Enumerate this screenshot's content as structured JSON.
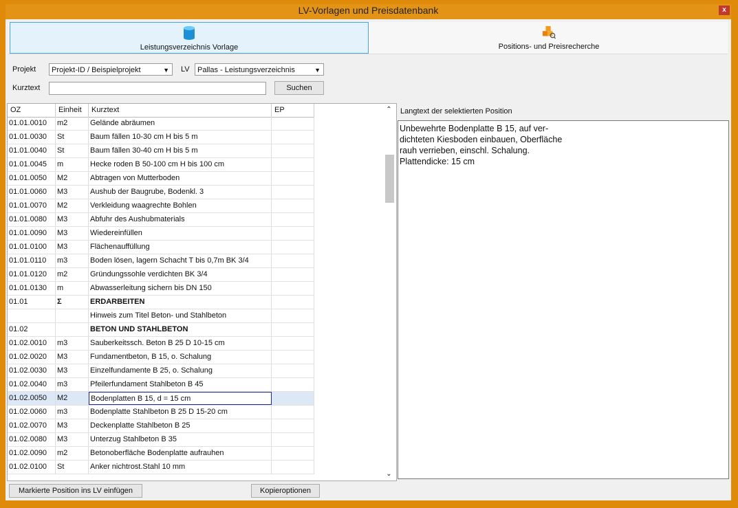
{
  "window": {
    "title": "LV-Vorlagen und Preisdatenbank",
    "close_label": "x"
  },
  "tabs": [
    {
      "label": "Leistungsverzeichnis Vorlage",
      "icon": "cylinder-database-icon",
      "active": true
    },
    {
      "label": "Positions- und Preisrecherche",
      "icon": "cubes-magnifier-icon",
      "active": false
    }
  ],
  "filters": {
    "projekt_label": "Projekt",
    "projekt_value": "Projekt-ID  / Beispielprojekt",
    "lv_label": "LV",
    "lv_value": "Pallas - Leistungsverzeichnis",
    "kurztext_label": "Kurztext",
    "kurztext_value": "",
    "search_label": "Suchen"
  },
  "table": {
    "columns": [
      "OZ",
      "Einheit",
      "Kurztext",
      "EP"
    ],
    "rows": [
      {
        "oz": "01.01.0010",
        "einheit": "m2",
        "kurztext": "Gelände abräumen",
        "ep": ""
      },
      {
        "oz": "01.01.0030",
        "einheit": "St",
        "kurztext": "Baum fällen 10-30 cm H bis 5 m",
        "ep": ""
      },
      {
        "oz": "01.01.0040",
        "einheit": "St",
        "kurztext": "Baum fällen 30-40 cm H bis 5 m",
        "ep": ""
      },
      {
        "oz": "01.01.0045",
        "einheit": "m",
        "kurztext": "Hecke roden B 50-100 cm H bis 100 cm",
        "ep": ""
      },
      {
        "oz": "01.01.0050",
        "einheit": "M2",
        "kurztext": "Abtragen von Mutterboden",
        "ep": ""
      },
      {
        "oz": "01.01.0060",
        "einheit": "M3",
        "kurztext": "Aushub der Baugrube, Bodenkl. 3",
        "ep": ""
      },
      {
        "oz": "01.01.0070",
        "einheit": "M2",
        "kurztext": "Verkleidung waagrechte Bohlen",
        "ep": ""
      },
      {
        "oz": "01.01.0080",
        "einheit": "M3",
        "kurztext": "Abfuhr des Aushubmaterials",
        "ep": ""
      },
      {
        "oz": "01.01.0090",
        "einheit": "M3",
        "kurztext": "Wiedereinfüllen",
        "ep": ""
      },
      {
        "oz": "01.01.0100",
        "einheit": "M3",
        "kurztext": "Flächenauffüllung",
        "ep": ""
      },
      {
        "oz": "01.01.0110",
        "einheit": "m3",
        "kurztext": "Boden lösen, lagern Schacht T bis 0,7m BK 3/4",
        "ep": ""
      },
      {
        "oz": "01.01.0120",
        "einheit": "m2",
        "kurztext": "Gründungssohle verdichten BK 3/4",
        "ep": ""
      },
      {
        "oz": "01.01.0130",
        "einheit": "m",
        "kurztext": "Abwasserleitung sichern bis DN 150",
        "ep": ""
      },
      {
        "oz": "01.01",
        "einheit": "Σ",
        "kurztext": "ERDARBEITEN",
        "ep": "",
        "bold": true
      },
      {
        "oz": "",
        "einheit": "",
        "kurztext": "Hinweis zum Titel Beton- und Stahlbeton",
        "ep": ""
      },
      {
        "oz": "01.02",
        "einheit": "",
        "kurztext": "BETON UND STAHLBETON",
        "ep": "",
        "bold": true
      },
      {
        "oz": "01.02.0010",
        "einheit": "m3",
        "kurztext": "Sauberkeitssch. Beton B 25 D 10-15 cm",
        "ep": ""
      },
      {
        "oz": "01.02.0020",
        "einheit": "M3",
        "kurztext": "Fundamentbeton, B 15, o. Schalung",
        "ep": ""
      },
      {
        "oz": "01.02.0030",
        "einheit": "M3",
        "kurztext": "Einzelfundamente B 25, o. Schalung",
        "ep": ""
      },
      {
        "oz": "01.02.0040",
        "einheit": "m3",
        "kurztext": "Pfeilerfundament Stahlbeton B 45",
        "ep": ""
      },
      {
        "oz": "01.02.0050",
        "einheit": "M2",
        "kurztext": "Bodenplatten B 15, d = 15 cm",
        "ep": "",
        "selected": true
      },
      {
        "oz": "01.02.0060",
        "einheit": "m3",
        "kurztext": "Bodenplatte Stahlbeton B 25 D 15-20 cm",
        "ep": ""
      },
      {
        "oz": "01.02.0070",
        "einheit": "M3",
        "kurztext": "Deckenplatte Stahlbeton B 25",
        "ep": ""
      },
      {
        "oz": "01.02.0080",
        "einheit": "M3",
        "kurztext": "Unterzug Stahlbeton B 35",
        "ep": ""
      },
      {
        "oz": "01.02.0090",
        "einheit": "m2",
        "kurztext": "Betonoberfläche Bodenplatte aufrauhen",
        "ep": ""
      },
      {
        "oz": "01.02.0100",
        "einheit": "St",
        "kurztext": "Anker nichtrost.Stahl 10 mm",
        "ep": ""
      }
    ]
  },
  "langtext": {
    "label": "Langtext der selektierten Position",
    "text": "Unbewehrte Bodenplatte B 15, auf ver-\ndichteten Kiesboden einbauen, Oberfläche\nrauh verrieben, einschl. Schalung.\nPlattendicke: 15 cm"
  },
  "footer": {
    "insert_label": "Markierte Position ins LV einfügen",
    "copy_label": "Kopieroptionen"
  },
  "colors": {
    "frame": "#e08a0a",
    "titlebar": "#e39316",
    "active_tab_border": "#4aa3df",
    "selection": "#dde8f6"
  }
}
